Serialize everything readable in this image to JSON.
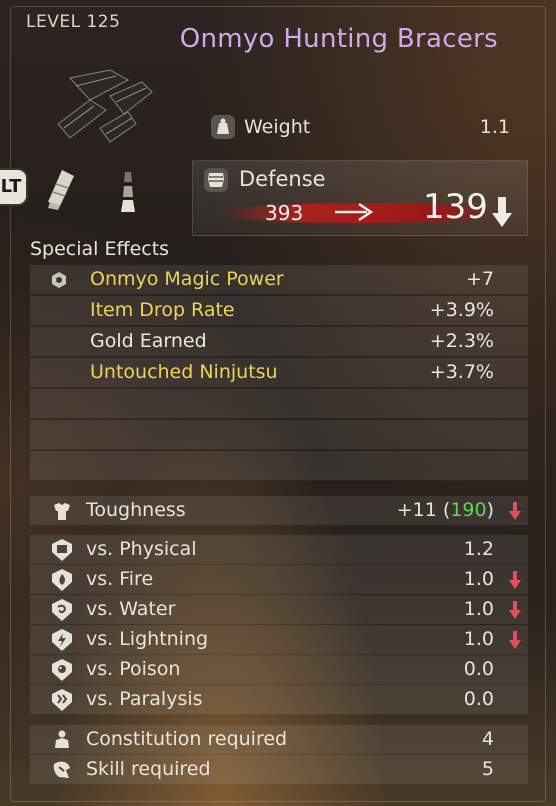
{
  "header": {
    "level": "LEVEL 125",
    "item_name": "Onmyo Hunting Bracers"
  },
  "badges": {
    "lt": "LT"
  },
  "weight": {
    "label": "Weight",
    "value": "1.1"
  },
  "defense": {
    "label": "Defense",
    "old_value": "393",
    "new_value": "139"
  },
  "special_effects": {
    "title": "Special Effects",
    "items": [
      {
        "name": "Onmyo Magic Power",
        "value": "+7",
        "color": "#efd25a"
      },
      {
        "name": "Item Drop Rate",
        "value": "+3.9%",
        "color": "#efd25a"
      },
      {
        "name": "Gold Earned",
        "value": "+2.3%",
        "color": "#ece8e0"
      },
      {
        "name": "Untouched Ninjutsu",
        "value": "+3.7%",
        "color": "#efd25a"
      }
    ]
  },
  "toughness": {
    "label": "Toughness",
    "value": "+11",
    "total": "190"
  },
  "resistances": [
    {
      "label": "vs. Physical",
      "value": "1.2",
      "decrease": false
    },
    {
      "label": "vs. Fire",
      "value": "1.0",
      "decrease": true
    },
    {
      "label": "vs. Water",
      "value": "1.0",
      "decrease": true
    },
    {
      "label": "vs. Lightning",
      "value": "1.0",
      "decrease": true
    },
    {
      "label": "vs. Poison",
      "value": "0.0",
      "decrease": false
    },
    {
      "label": "vs. Paralysis",
      "value": "0.0",
      "decrease": false
    }
  ],
  "requirements": [
    {
      "label": "Constitution required",
      "value": "4"
    },
    {
      "label": "Skill required",
      "value": "5"
    }
  ],
  "colors": {
    "title": "#cfa8ee",
    "highlight": "#efd25a",
    "increase": "#5fd45a",
    "decrease": "#e0505a"
  }
}
